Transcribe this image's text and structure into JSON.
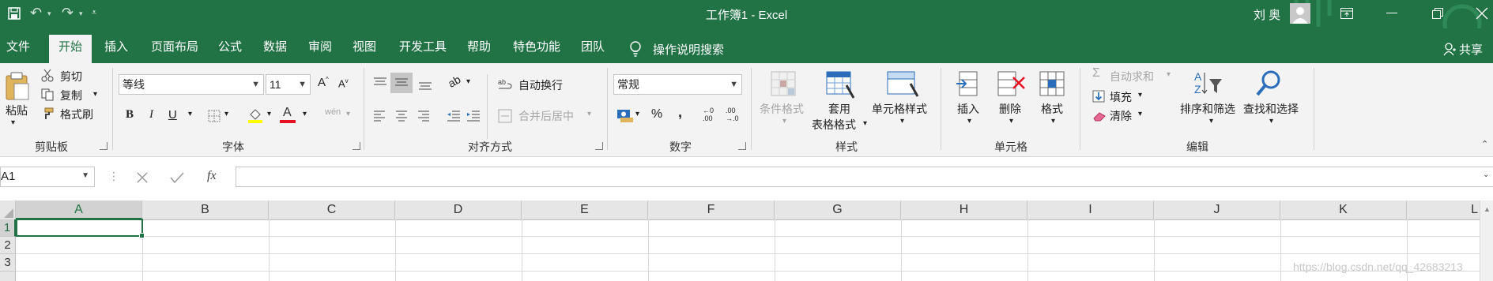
{
  "window": {
    "title": "工作簿1 - Excel",
    "user": "刘 奥"
  },
  "tabs": [
    "文件",
    "开始",
    "插入",
    "页面布局",
    "公式",
    "数据",
    "审阅",
    "视图",
    "开发工具",
    "帮助",
    "特色功能",
    "团队"
  ],
  "active_tab": "开始",
  "tell_me": "操作说明搜索",
  "share": "共享",
  "clipboard": {
    "paste": "粘贴",
    "cut": "剪切",
    "copy": "复制",
    "format_painter": "格式刷",
    "group": "剪贴板"
  },
  "font": {
    "name": "等线",
    "size": "11",
    "bold": "B",
    "italic": "I",
    "underline": "U",
    "group": "字体",
    "phonetic": "wén"
  },
  "alignment": {
    "wrap": "自动换行",
    "merge": "合并后居中",
    "group": "对齐方式"
  },
  "number": {
    "format": "常规",
    "percent": "%",
    "comma": ",",
    "group": "数字"
  },
  "styles": {
    "conditional": "条件格式",
    "table_line1": "套用",
    "table_line2": "表格格式",
    "cell_styles": "单元格样式",
    "group": "样式"
  },
  "cells": {
    "insert": "插入",
    "delete": "删除",
    "format": "格式",
    "group": "单元格"
  },
  "editing": {
    "autosum": "自动求和",
    "fill": "填充",
    "clear": "清除",
    "sort": "排序和筛选",
    "find": "查找和选择",
    "group": "编辑"
  },
  "formula_bar": {
    "name_box": "A1",
    "fx": "fx",
    "value": ""
  },
  "columns": [
    "A",
    "B",
    "C",
    "D",
    "E",
    "F",
    "G",
    "H",
    "I",
    "J",
    "K",
    "L"
  ],
  "rows": [
    "1",
    "2",
    "3"
  ],
  "watermark": "https://blog.csdn.net/qq_42683213",
  "colors": {
    "excel_green": "#217346",
    "ribbon_bg": "#f3f3f3",
    "font_color_red": "#e81123",
    "highlight_yellow": "#ffff00",
    "selected_cell_border": "#217346"
  }
}
